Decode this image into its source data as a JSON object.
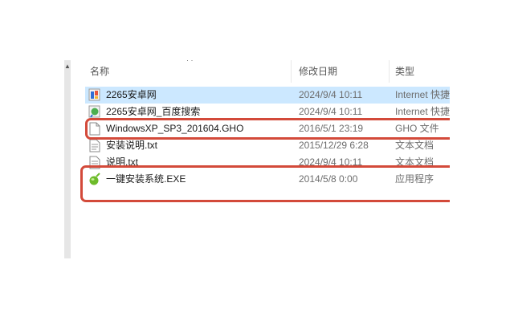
{
  "columns": {
    "name": "名称",
    "date": "修改日期",
    "type": "类型"
  },
  "files": [
    {
      "name": "2265安卓网",
      "date": "2024/9/4 10:11",
      "type": "Internet 快捷",
      "icon": "internet-shortcut-icon"
    },
    {
      "name": "2265安卓网_百度搜索",
      "date": "2024/9/4 10:11",
      "type": "Internet 快捷",
      "icon": "internet-shortcut-icon"
    },
    {
      "name": "WindowsXP_SP3_201604.GHO",
      "date": "2016/5/1 23:19",
      "type": "GHO 文件",
      "icon": "blank-file-icon"
    },
    {
      "name": "安装说明.txt",
      "date": "2015/12/29 6:28",
      "type": "文本文档",
      "icon": "text-file-icon"
    },
    {
      "name": "说明.txt",
      "date": "2024/9/4 10:11",
      "type": "文本文档",
      "icon": "text-file-icon"
    },
    {
      "name": "一键安装系统.EXE",
      "date": "2014/5/8 0:00",
      "type": "应用程序",
      "icon": "green-app-icon"
    }
  ],
  "highlight_color": "#d34a3a",
  "selection_color": "#cce8ff"
}
